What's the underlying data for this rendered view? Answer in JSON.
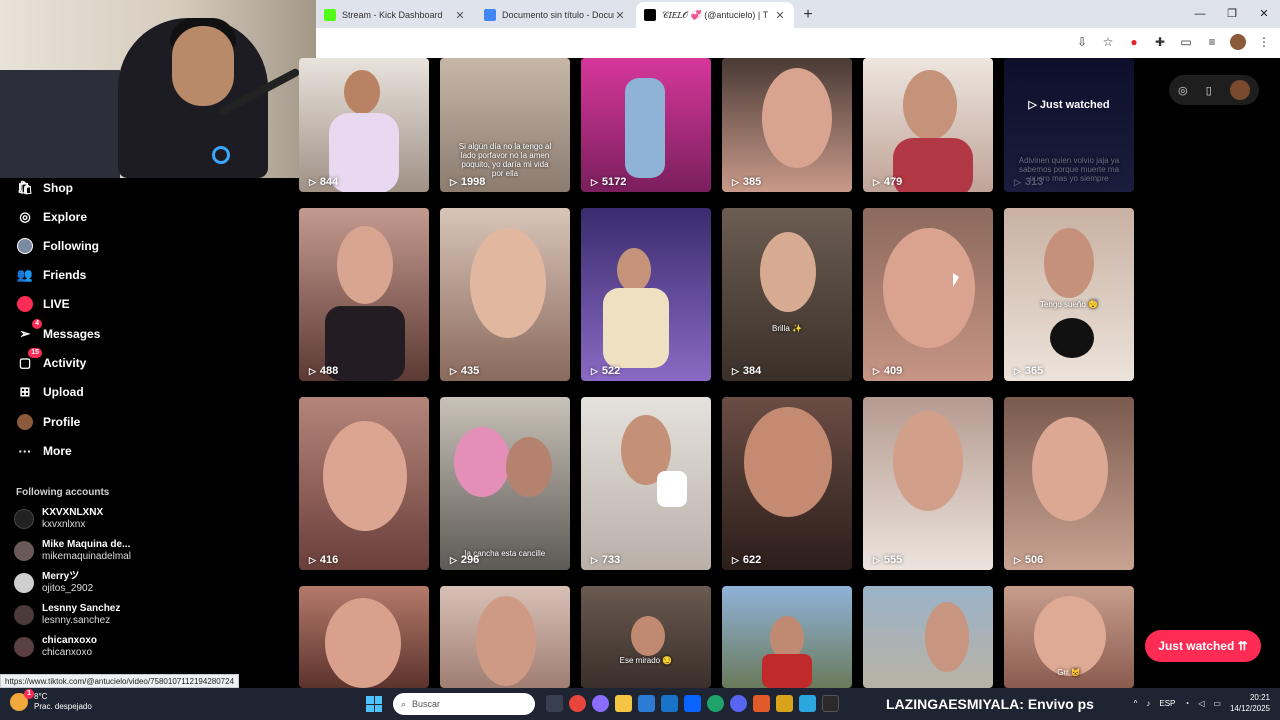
{
  "browser": {
    "tabs": [
      {
        "label": "Stream - Kick Dashboard",
        "favicon_color": "#53fc18",
        "active": false
      },
      {
        "label": "Documento sin título - Docume",
        "favicon_color": "#4285f4",
        "active": false
      },
      {
        "label": "𝒞𝐼𝐸𝐿𝒪 💞 (@antucielo) | T",
        "favicon_color": "#000000",
        "active": true
      }
    ],
    "new_tab": "+"
  },
  "nav": {
    "items": [
      {
        "label": "Shop",
        "icon": "shop-icon"
      },
      {
        "label": "Explore",
        "icon": "compass-icon"
      },
      {
        "label": "Following",
        "icon": "following-avatar-icon"
      },
      {
        "label": "Friends",
        "icon": "friends-icon"
      },
      {
        "label": "LIVE",
        "icon": "live-icon"
      },
      {
        "label": "Messages",
        "icon": "messages-icon",
        "badge": "4"
      },
      {
        "label": "Activity",
        "icon": "activity-icon",
        "badge": "15"
      },
      {
        "label": "Upload",
        "icon": "upload-icon"
      },
      {
        "label": "Profile",
        "icon": "profile-avatar-icon"
      },
      {
        "label": "More",
        "icon": "more-icon"
      }
    ],
    "following_title": "Following accounts",
    "accounts": [
      {
        "name": "KXVXNLXNX",
        "username": "kxvxnlxnx"
      },
      {
        "name": "Mike Maquina de...",
        "username": "mikemaquinadelmal"
      },
      {
        "name": "Merryツ",
        "username": "ojitos_2902"
      },
      {
        "name": "Lesnny Sanchez",
        "username": "lesnny.sanchez"
      },
      {
        "name": "chicanxoxo",
        "username": "chicanxoxo"
      }
    ]
  },
  "status_url": "https://www.tiktok.com/@antucielo/video/7580107112194280724",
  "grid": {
    "rows": [
      [
        {
          "views": "844",
          "caption": ""
        },
        {
          "views": "1998",
          "caption": "Si algún día no la tengo al lado porfavor no la amen poquito, yo daría mi vida por ella"
        },
        {
          "views": "5172",
          "caption": ""
        },
        {
          "views": "385",
          "caption": ""
        },
        {
          "views": "479",
          "caption": ""
        },
        {
          "views": "313",
          "caption": "Adivinen quien volvio jaja ya sabemos porque muerte ma puero mas yo siempre",
          "just_watched": "Just watched"
        }
      ],
      [
        {
          "views": "488",
          "caption": ""
        },
        {
          "views": "435",
          "caption": ""
        },
        {
          "views": "522",
          "caption": ""
        },
        {
          "views": "384",
          "caption": "Brilla ✨"
        },
        {
          "views": "409",
          "caption": ""
        },
        {
          "views": "365",
          "caption": "Tengo sueño 😴"
        }
      ],
      [
        {
          "views": "416",
          "caption": ""
        },
        {
          "views": "296",
          "caption": "la cancha esta cancille"
        },
        {
          "views": "733",
          "caption": ""
        },
        {
          "views": "622",
          "caption": ""
        },
        {
          "views": "555",
          "caption": ""
        },
        {
          "views": "506",
          "caption": ""
        }
      ],
      [
        {
          "views": "",
          "caption": ""
        },
        {
          "views": "",
          "caption": ""
        },
        {
          "views": "",
          "caption": "Ese mirado 😏"
        },
        {
          "views": "",
          "caption": ""
        },
        {
          "views": "",
          "caption": ""
        },
        {
          "views": "",
          "caption": "Grr 😼"
        }
      ]
    ]
  },
  "just_watched_button": "Just watched ⇈",
  "taskbar": {
    "temperature": "8°C",
    "weather": "Prac. despejado",
    "weather_badge": "1",
    "search_placeholder": "Buscar",
    "ticker": "LAZINGAESMIYALA: Envivo ps",
    "language": "ESP",
    "time": "20:21",
    "date": "14/12/2025"
  },
  "colors": {
    "accent": "#fe2c55",
    "background": "#000000",
    "taskbar": "#1f2433"
  }
}
